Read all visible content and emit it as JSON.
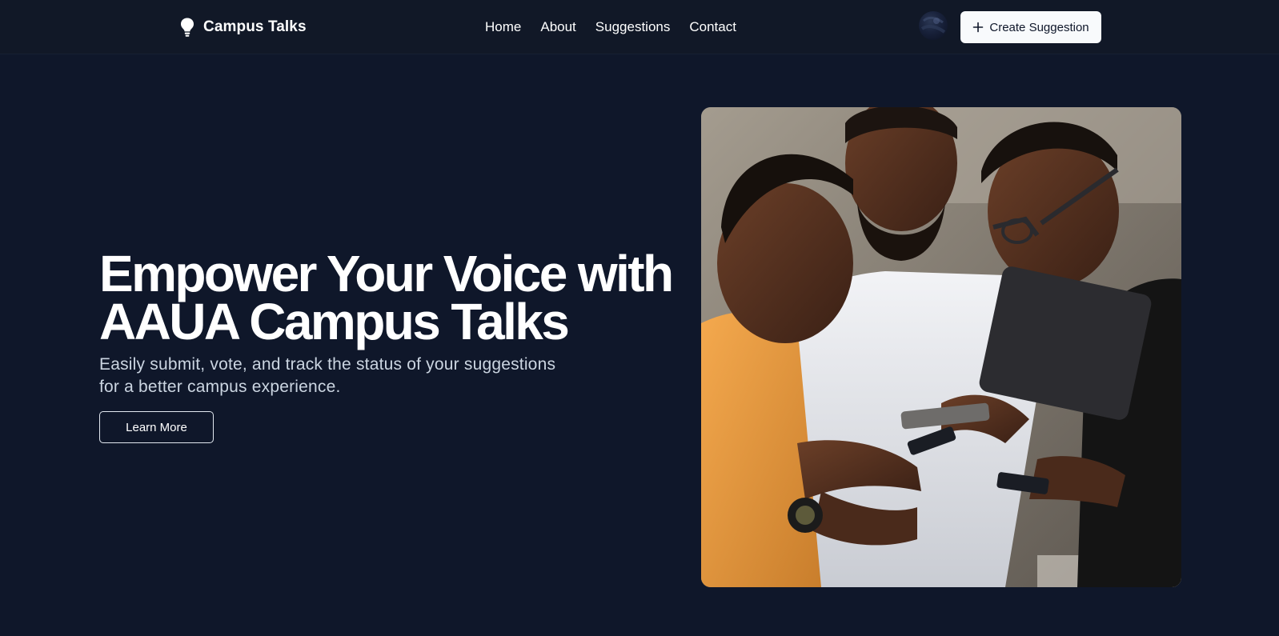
{
  "header": {
    "brand_name": "Campus Talks",
    "brand_icon": "lightbulb-icon",
    "nav": [
      {
        "label": "Home"
      },
      {
        "label": "About"
      },
      {
        "label": "Suggestions"
      },
      {
        "label": "Contact"
      }
    ],
    "create_button_label": "Create Suggestion",
    "create_button_icon": "plus-icon"
  },
  "hero": {
    "title_line1": "Empower Your Voice with",
    "title_line2": "AAUA Campus Talks",
    "subtitle_line1": "Easily submit, vote, and track the status of your suggestions",
    "subtitle_line2": "for a better campus experience.",
    "cta_label": "Learn More"
  },
  "colors": {
    "background": "#0f172a",
    "header_background": "#111827",
    "primary_button_bg": "#f8fafc",
    "primary_button_text": "#0f172a",
    "subtitle_text": "#cbd5e1"
  }
}
